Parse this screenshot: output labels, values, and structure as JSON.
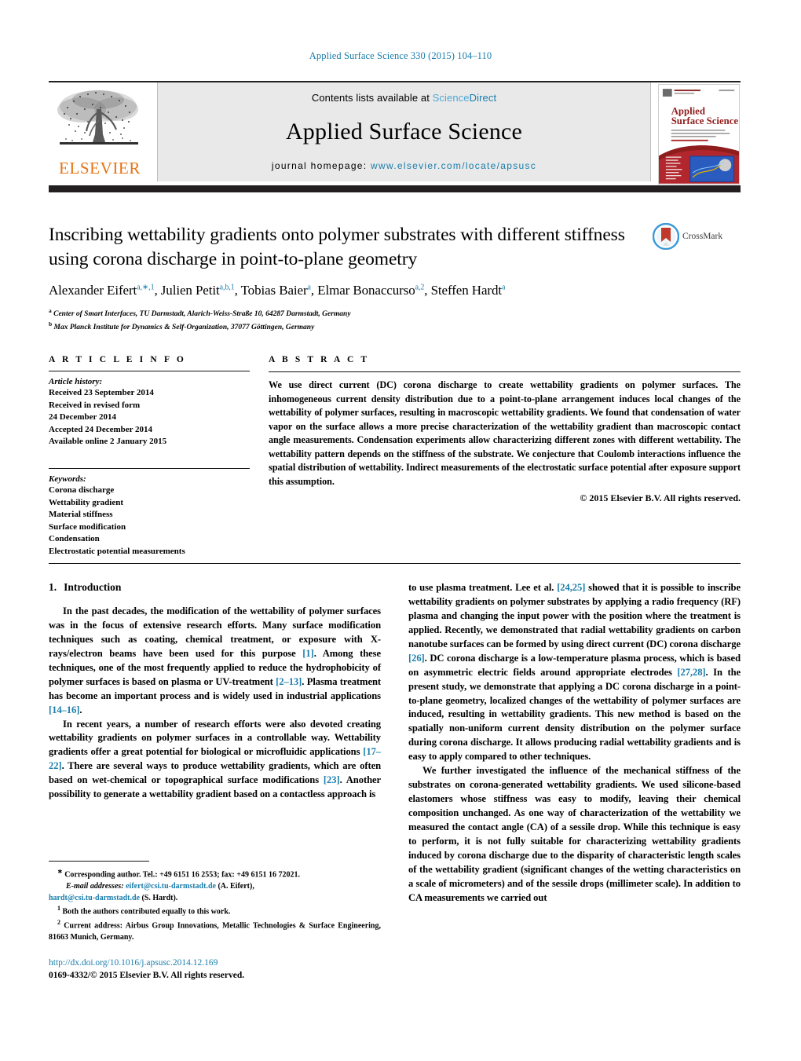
{
  "running_head": "Applied Surface Science 330 (2015) 104–110",
  "masthead": {
    "publisher_name": "ELSEVIER",
    "contents_prefix": "Contents lists available at ",
    "contents_link_science": "Science",
    "contents_link_direct": "Direct",
    "journal_name": "Applied Surface Science",
    "homepage_prefix": "journal homepage: ",
    "homepage_url": "www.elsevier.com/locate/apsusc",
    "cover_title_line1": "Applied",
    "cover_title_line2": "Surface Science"
  },
  "crossmark": {
    "label": "CrossMark"
  },
  "article": {
    "title": "Inscribing wettability gradients onto polymer substrates with different stiffness using corona discharge in point-to-plane geometry",
    "authors_html": "Alexander Eifert<sup>a,∗,1</sup>, Julien Petit<sup>a,b,1</sup>, Tobias Baier<sup>a</sup>, Elmar Bonaccurso<sup>a,2</sup>, Steffen Hardt<sup>a</sup>",
    "affiliations": [
      {
        "mark": "a",
        "text": "Center of Smart Interfaces, TU Darmstadt, Alarich-Weiss-Straße 10, 64287 Darmstadt, Germany"
      },
      {
        "mark": "b",
        "text": "Max Planck Institute for Dynamics & Self-Organization, 37077 Göttingen, Germany"
      }
    ]
  },
  "article_info": {
    "heading": "A R T I C L E   I N F O",
    "history_label": "Article history:",
    "history_lines": [
      "Received 23 September 2014",
      "Received in revised form",
      "24 December 2014",
      "Accepted 24 December 2014",
      "Available online 2 January 2015"
    ],
    "keywords_label": "Keywords:",
    "keywords": [
      "Corona discharge",
      "Wettability gradient",
      "Material stiffness",
      "Surface modification",
      "Condensation",
      "Electrostatic potential measurements"
    ]
  },
  "abstract": {
    "heading": "A B S T R A C T",
    "text": "We use direct current (DC) corona discharge to create wettability gradients on polymer surfaces. The inhomogeneous current density distribution due to a point-to-plane arrangement induces local changes of the wettability of polymer surfaces, resulting in macroscopic wettability gradients. We found that condensation of water vapor on the surface allows a more precise characterization of the wettability gradient than macroscopic contact angle measurements. Condensation experiments allow characterizing different zones with different wettability. The wettability pattern depends on the stiffness of the substrate. We conjecture that Coulomb interactions influence the spatial distribution of wettability. Indirect measurements of the electrostatic surface potential after exposure support this assumption.",
    "copyright": "© 2015 Elsevier B.V. All rights reserved."
  },
  "body": {
    "section_number": "1.",
    "section_title": "Introduction",
    "left_paragraphs": [
      {
        "segments": [
          {
            "t": "In the past decades, the modification of the wettability of polymer surfaces was in the focus of extensive research efforts. Many surface modification techniques such as coating, chemical treatment, or exposure with X-rays/electron beams have been used for this purpose "
          },
          {
            "t": "[1]",
            "ref": true
          },
          {
            "t": ". Among these techniques, one of the most frequently applied to reduce the hydrophobicity of polymer surfaces is based on plasma or UV-treatment "
          },
          {
            "t": "[2–13]",
            "ref": true
          },
          {
            "t": ". Plasma treatment has become an important process and is widely used in industrial applications "
          },
          {
            "t": "[14–16]",
            "ref": true
          },
          {
            "t": "."
          }
        ]
      },
      {
        "segments": [
          {
            "t": "In recent years, a number of research efforts were also devoted creating wettability gradients on polymer surfaces in a controllable way. Wettability gradients offer a great potential for biological or microfluidic applications "
          },
          {
            "t": "[17–22]",
            "ref": true
          },
          {
            "t": ". There are several ways to produce wettability gradients, which are often based on wet-chemical or topographical surface modifications "
          },
          {
            "t": "[23]",
            "ref": true
          },
          {
            "t": ". Another possibility to generate a wettability gradient based on a contactless approach is"
          }
        ]
      }
    ],
    "right_paragraphs": [
      {
        "continued": true,
        "segments": [
          {
            "t": "to use plasma treatment. Lee et al. "
          },
          {
            "t": "[24,25]",
            "ref": true
          },
          {
            "t": " showed that it is possible to inscribe wettability gradients on polymer substrates by applying a radio frequency (RF) plasma and changing the input power with the position where the treatment is applied. Recently, we demonstrated that radial wettability gradients on carbon nanotube surfaces can be formed by using direct current (DC) corona discharge "
          },
          {
            "t": "[26]",
            "ref": true
          },
          {
            "t": ". DC corona discharge is a low-temperature plasma process, which is based on asymmetric electric fields around appropriate electrodes "
          },
          {
            "t": "[27,28]",
            "ref": true
          },
          {
            "t": ". In the present study, we demonstrate that applying a DC corona discharge in a point-to-plane geometry, localized changes of the wettability of polymer surfaces are induced, resulting in wettability gradients. This new method is based on the spatially non-uniform current density distribution on the polymer surface during corona discharge. It allows producing radial wettability gradients and is easy to apply compared to other techniques."
          }
        ]
      },
      {
        "segments": [
          {
            "t": "We further investigated the influence of the mechanical stiffness of the substrates on corona-generated wettability gradients. We used silicone-based elastomers whose stiffness was easy to modify, leaving their chemical composition unchanged. As one way of characterization of the wettability we measured the contact angle (CA) of a sessile drop. While this technique is easy to perform, it is not fully suitable for characterizing wettability gradients induced by corona discharge due to the disparity of characteristic length scales of the wettability gradient (significant changes of the wetting characteristics on a scale of micrometers) and of the sessile drops (millimeter scale). In addition to CA measurements we carried out"
          }
        ]
      }
    ]
  },
  "footnotes": {
    "corresponding": {
      "mark": "∗",
      "text": "Corresponding author. Tel.: +49 6151 16 2553; fax: +49 6151 16 72021."
    },
    "email_label": "E-mail addresses:",
    "email_1": "eifert@csi.tu-darmstadt.de",
    "email_1_owner": "(A. Eifert),",
    "email_2": "hardt@csi.tu-darmstadt.de",
    "email_2_owner": "(S. Hardt).",
    "note_1_mark": "1",
    "note_1": "Both the authors contributed equally to this work.",
    "note_2_mark": "2",
    "note_2": "Current address: Airbus Group Innovations, Metallic Technologies & Surface Engineering, 81663 Munich, Germany."
  },
  "doi": {
    "url": "http://dx.doi.org/10.1016/j.apsusc.2014.12.169",
    "issn_line": "0169-4332/© 2015 Elsevier B.V. All rights reserved."
  },
  "colors": {
    "link_blue": "#1a7dab",
    "science_blue": "#4fa8d8",
    "elsevier_orange": "#e87211",
    "rule_dark": "#231f20",
    "band_gray": "#e9e9e9",
    "crossmark_red": "#c0392b",
    "crossmark_blue": "#3a99d8"
  }
}
